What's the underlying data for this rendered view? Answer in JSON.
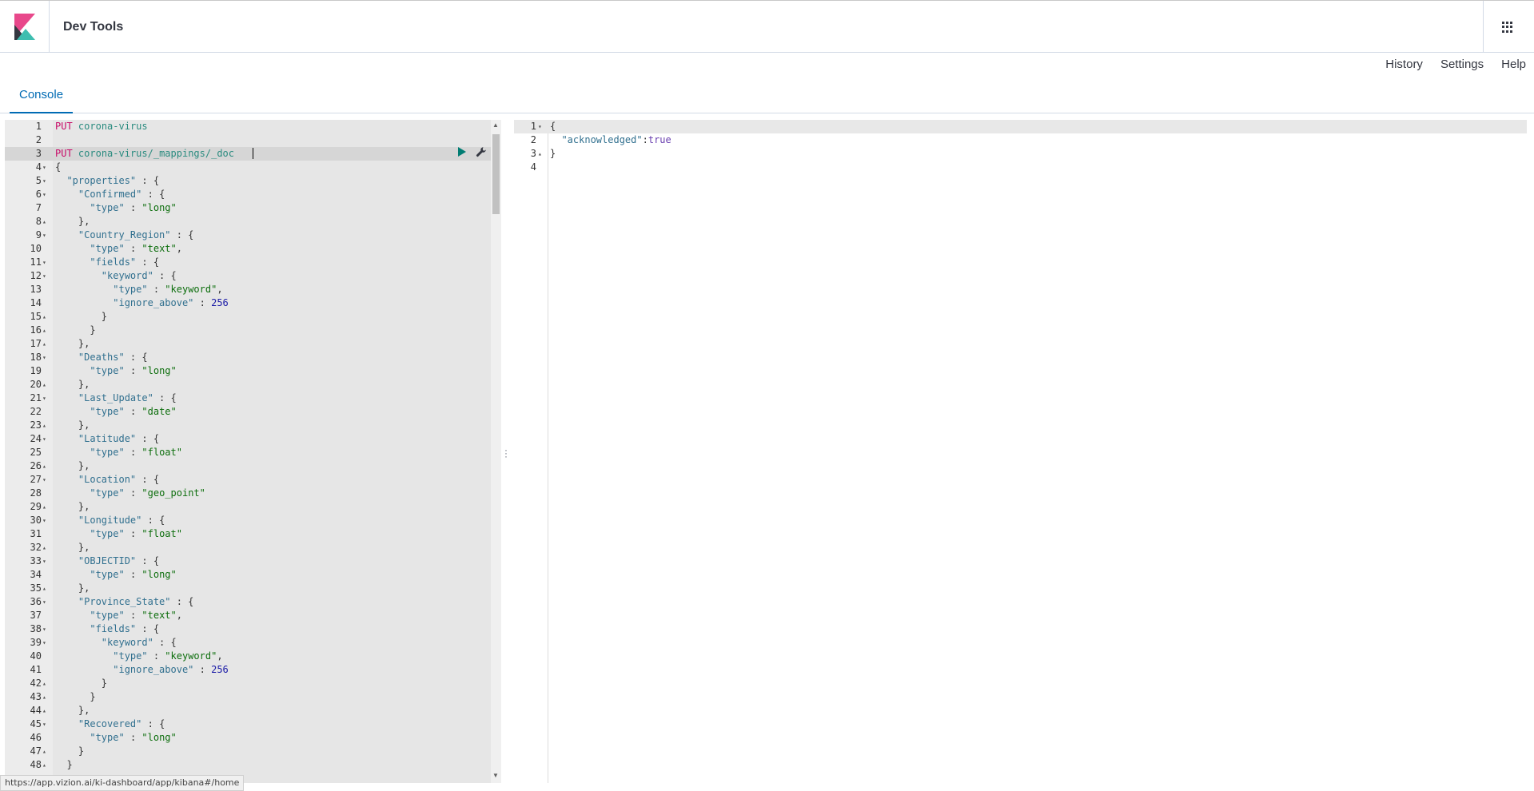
{
  "app": {
    "title": "Dev Tools"
  },
  "menu": {
    "history": "History",
    "settings": "Settings",
    "help": "Help"
  },
  "tabs": [
    {
      "label": "Console"
    }
  ],
  "editor": {
    "lines": [
      {
        "n": "1",
        "fold": "",
        "text": "PUT corona-virus"
      },
      {
        "n": "2",
        "fold": "",
        "text": ""
      },
      {
        "n": "3",
        "fold": "",
        "text": "PUT corona-virus/_mappings/_doc"
      },
      {
        "n": "4",
        "fold": "▾",
        "text": "{"
      },
      {
        "n": "5",
        "fold": "▾",
        "text": "  \"properties\" : {"
      },
      {
        "n": "6",
        "fold": "▾",
        "text": "    \"Confirmed\" : {"
      },
      {
        "n": "7",
        "fold": "",
        "text": "      \"type\" : \"long\""
      },
      {
        "n": "8",
        "fold": "▴",
        "text": "    },"
      },
      {
        "n": "9",
        "fold": "▾",
        "text": "    \"Country_Region\" : {"
      },
      {
        "n": "10",
        "fold": "",
        "text": "      \"type\" : \"text\","
      },
      {
        "n": "11",
        "fold": "▾",
        "text": "      \"fields\" : {"
      },
      {
        "n": "12",
        "fold": "▾",
        "text": "        \"keyword\" : {"
      },
      {
        "n": "13",
        "fold": "",
        "text": "          \"type\" : \"keyword\","
      },
      {
        "n": "14",
        "fold": "",
        "text": "          \"ignore_above\" : 256"
      },
      {
        "n": "15",
        "fold": "▴",
        "text": "        }"
      },
      {
        "n": "16",
        "fold": "▴",
        "text": "      }"
      },
      {
        "n": "17",
        "fold": "▴",
        "text": "    },"
      },
      {
        "n": "18",
        "fold": "▾",
        "text": "    \"Deaths\" : {"
      },
      {
        "n": "19",
        "fold": "",
        "text": "      \"type\" : \"long\""
      },
      {
        "n": "20",
        "fold": "▴",
        "text": "    },"
      },
      {
        "n": "21",
        "fold": "▾",
        "text": "    \"Last_Update\" : {"
      },
      {
        "n": "22",
        "fold": "",
        "text": "      \"type\" : \"date\""
      },
      {
        "n": "23",
        "fold": "▴",
        "text": "    },"
      },
      {
        "n": "24",
        "fold": "▾",
        "text": "    \"Latitude\" : {"
      },
      {
        "n": "25",
        "fold": "",
        "text": "      \"type\" : \"float\""
      },
      {
        "n": "26",
        "fold": "▴",
        "text": "    },"
      },
      {
        "n": "27",
        "fold": "▾",
        "text": "    \"Location\" : {"
      },
      {
        "n": "28",
        "fold": "",
        "text": "      \"type\" : \"geo_point\""
      },
      {
        "n": "29",
        "fold": "▴",
        "text": "    },"
      },
      {
        "n": "30",
        "fold": "▾",
        "text": "    \"Longitude\" : {"
      },
      {
        "n": "31",
        "fold": "",
        "text": "      \"type\" : \"float\""
      },
      {
        "n": "32",
        "fold": "▴",
        "text": "    },"
      },
      {
        "n": "33",
        "fold": "▾",
        "text": "    \"OBJECTID\" : {"
      },
      {
        "n": "34",
        "fold": "",
        "text": "      \"type\" : \"long\""
      },
      {
        "n": "35",
        "fold": "▴",
        "text": "    },"
      },
      {
        "n": "36",
        "fold": "▾",
        "text": "    \"Province_State\" : {"
      },
      {
        "n": "37",
        "fold": "",
        "text": "      \"type\" : \"text\","
      },
      {
        "n": "38",
        "fold": "▾",
        "text": "      \"fields\" : {"
      },
      {
        "n": "39",
        "fold": "▾",
        "text": "        \"keyword\" : {"
      },
      {
        "n": "40",
        "fold": "",
        "text": "          \"type\" : \"keyword\","
      },
      {
        "n": "41",
        "fold": "",
        "text": "          \"ignore_above\" : 256"
      },
      {
        "n": "42",
        "fold": "▴",
        "text": "        }"
      },
      {
        "n": "43",
        "fold": "▴",
        "text": "      }"
      },
      {
        "n": "44",
        "fold": "▴",
        "text": "    },"
      },
      {
        "n": "45",
        "fold": "▾",
        "text": "    \"Recovered\" : {"
      },
      {
        "n": "46",
        "fold": "",
        "text": "      \"type\" : \"long\""
      },
      {
        "n": "47",
        "fold": "▴",
        "text": "    }"
      },
      {
        "n": "48",
        "fold": "▴",
        "text": "  }"
      }
    ]
  },
  "output": {
    "lines": [
      {
        "n": "1",
        "fold": "▾",
        "text": "{"
      },
      {
        "n": "2",
        "fold": "",
        "text": "  \"acknowledged\":true"
      },
      {
        "n": "3",
        "fold": "▴",
        "text": "}"
      },
      {
        "n": "4",
        "fold": "",
        "text": ""
      }
    ]
  },
  "statusbar": {
    "url": "https://app.vizion.ai/ki-dashboard/app/kibana#/home"
  },
  "icons": {
    "run": "play-icon",
    "settings": "wrench-icon",
    "apps": "grid-icon",
    "logo": "kibana-logo"
  },
  "colors": {
    "accent": "#006bb4",
    "run": "#017d73",
    "logo_pink": "#e8488b",
    "logo_teal": "#3ebeb0"
  }
}
